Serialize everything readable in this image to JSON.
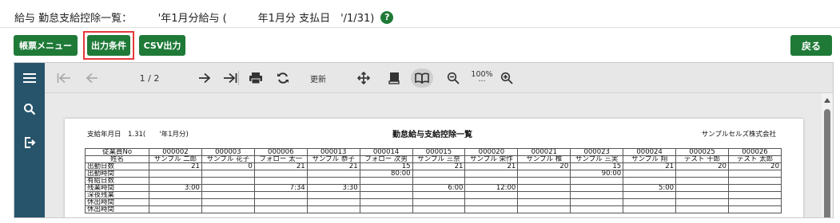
{
  "header": {
    "title": "給与 勤怠支給控除一覧：　　　'年1月分給与 (　　　年1月分 支払日　'/1/31)",
    "help_icon": "question-circle-icon"
  },
  "buttons": {
    "report_menu": "帳票メニュー",
    "output_conditions": "出力条件",
    "csv_output": "CSV出力",
    "back": "戻る"
  },
  "colors": {
    "accent": "#1f7a38",
    "highlight": "#e5393a",
    "sidebar": "#27546b"
  },
  "toolbar": {
    "page": "1 / 2",
    "refresh_label": "更新",
    "zoom": "100%",
    "zoom_more": "···"
  },
  "report": {
    "date_label": "支給年月日　1.31(　　'年1月分)",
    "title": "勤怠給与支給控除一覧",
    "company": "サンプルセルズ株式会社",
    "rows": [
      {
        "label": "従業員No",
        "values": [
          "000002",
          "000003",
          "000006",
          "000013",
          "000014",
          "000015",
          "000020",
          "000021",
          "000023",
          "000024",
          "000025",
          "000026"
        ]
      },
      {
        "label": "姓名",
        "values": [
          "サンプル 二郎",
          "サンプル 花子",
          "フォロー 太一",
          "サンプル 恭子",
          "フォロー 次男",
          "サンプル 三奈",
          "サンプル 栄作",
          "サンプル 椎",
          "サンプル 三実",
          "サンプル 翔",
          "テスト 十郎",
          "テスト 太郎"
        ]
      },
      {
        "label": "出勤日数",
        "values": [
          "21",
          "0",
          "21",
          "21",
          "15",
          "21",
          "21",
          "20",
          "15",
          "21",
          "20",
          "20"
        ]
      },
      {
        "label": "出勤時間",
        "values": [
          "",
          "",
          "",
          "",
          "80:00",
          "",
          "",
          "",
          "90:00",
          "",
          "",
          ""
        ]
      },
      {
        "label": "有給日数",
        "values": [
          "",
          "",
          "",
          "",
          "",
          "",
          "",
          "",
          "",
          "",
          "",
          ""
        ]
      },
      {
        "label": "残業時間",
        "values": [
          "3:00",
          "",
          "7:34",
          "3:30",
          "",
          "6:00",
          "12:00",
          "",
          "",
          "5:00",
          "",
          ""
        ]
      },
      {
        "label": "深夜残業",
        "values": [
          "",
          "",
          "",
          "",
          "",
          "",
          "",
          "",
          "",
          "",
          "",
          ""
        ]
      },
      {
        "label": "休出時間",
        "values": [
          "",
          "",
          "",
          "",
          "",
          "",
          "",
          "",
          "",
          "",
          "",
          ""
        ]
      },
      {
        "label": "休出時間",
        "values": [
          "",
          "",
          "",
          "",
          "",
          "",
          "",
          "",
          "",
          "",
          "",
          ""
        ]
      }
    ]
  }
}
